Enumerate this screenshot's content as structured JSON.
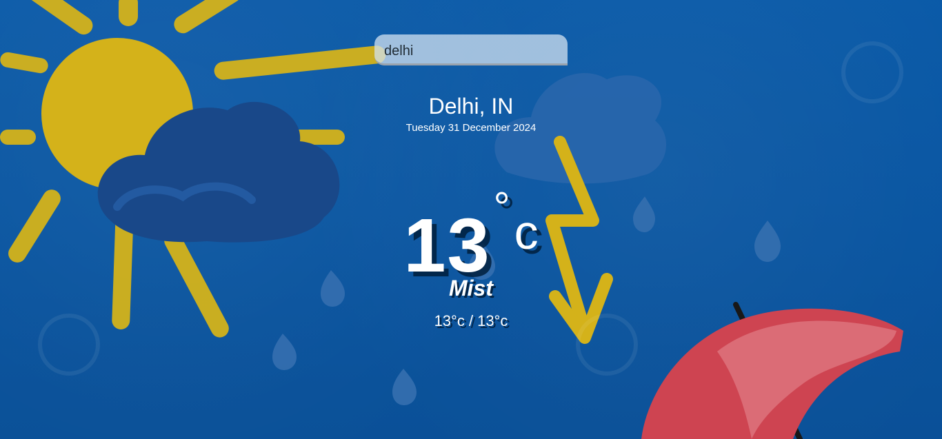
{
  "search": {
    "value": "delhi",
    "placeholder": ""
  },
  "location": {
    "city": "Delhi, IN",
    "date": "Tuesday 31 December 2024"
  },
  "weather": {
    "temperature": "13",
    "degree_symbol": "°",
    "unit": "c",
    "condition": "Mist",
    "hi_low": "13°c / 13°c"
  },
  "background": {
    "elements": [
      "sun",
      "clouds",
      "rain-drops",
      "zigzag-arrow",
      "umbrella"
    ],
    "colors": {
      "sky": "#0a5fb4",
      "sun": "#e7c21d",
      "cloud": "#1c4f95",
      "umbrella": "#e04a58"
    }
  }
}
